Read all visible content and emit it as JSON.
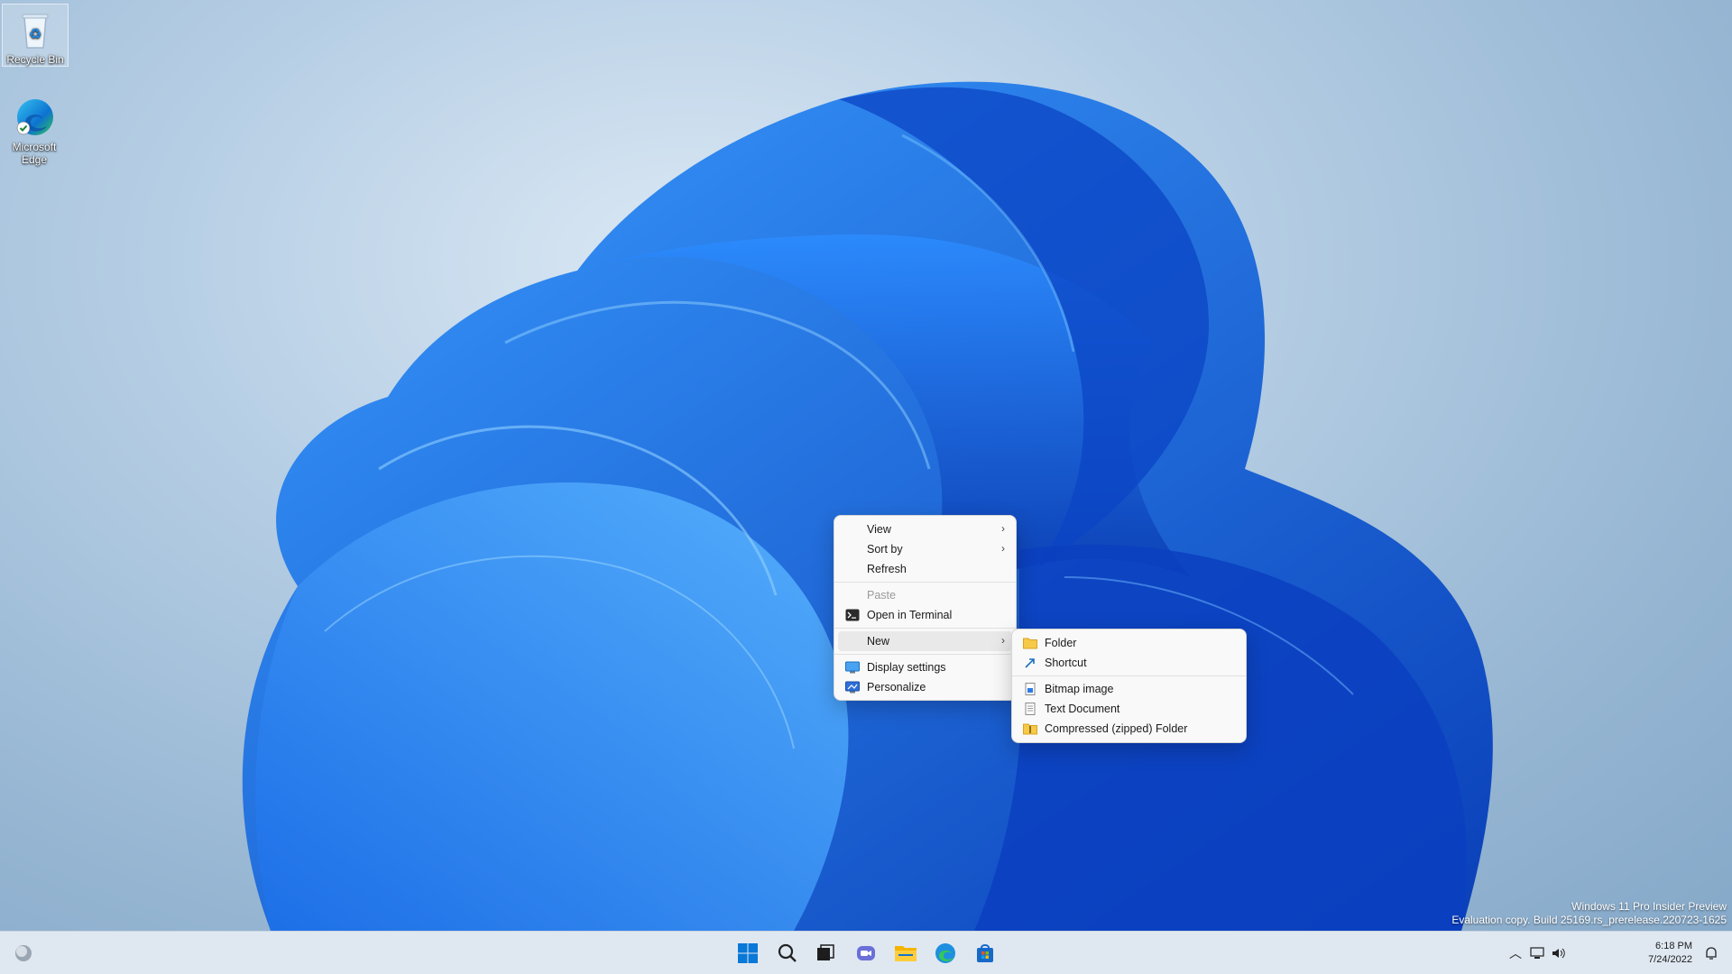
{
  "desktop": {
    "icons": [
      {
        "label": "Recycle Bin",
        "icon": "recycle-bin-icon"
      },
      {
        "label": "Microsoft Edge",
        "icon": "edge-icon"
      }
    ]
  },
  "context_menu": {
    "items": {
      "view": "View",
      "sort_by": "Sort by",
      "refresh": "Refresh",
      "paste": "Paste",
      "open_terminal": "Open in Terminal",
      "new": "New",
      "display_settings": "Display settings",
      "personalize": "Personalize"
    }
  },
  "new_submenu": {
    "items": {
      "folder": "Folder",
      "shortcut": "Shortcut",
      "bitmap": "Bitmap image",
      "text_document": "Text Document",
      "compressed": "Compressed (zipped) Folder"
    }
  },
  "watermark": {
    "line1": "Windows 11 Pro Insider Preview",
    "line2": "Evaluation copy. Build 25169.rs_prerelease.220723-1625"
  },
  "taskbar": {
    "apps": [
      "start-icon",
      "search-icon",
      "task-view-icon",
      "chat-icon",
      "file-explorer-icon",
      "edge-icon",
      "store-icon"
    ],
    "clock": {
      "time": "6:18 PM",
      "date": "7/24/2022"
    }
  },
  "colors": {
    "accent": "#0a5fd6",
    "menu_bg": "#f9f9f9",
    "taskbar_bg": "#dfe8f1"
  }
}
